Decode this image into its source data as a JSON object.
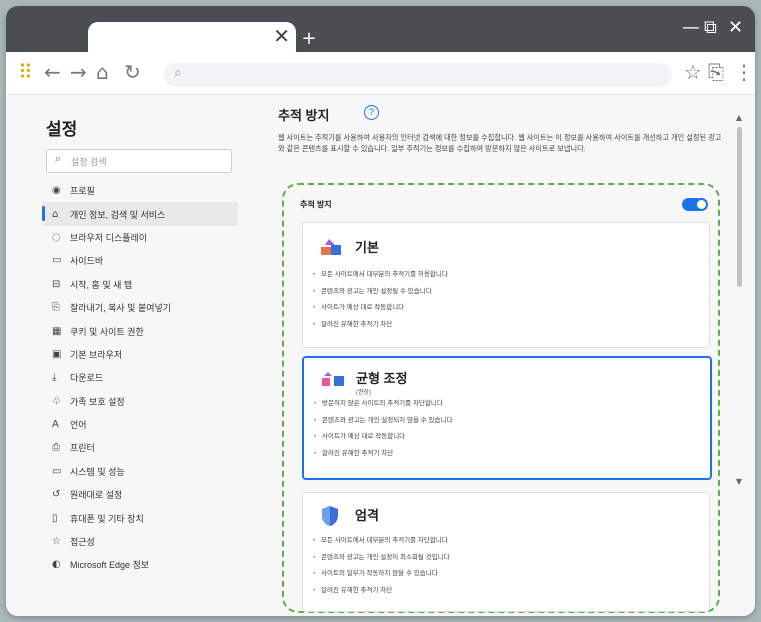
{
  "window": {
    "tab_close": "✕",
    "new_tab": "+",
    "controls": {
      "minimize": "—",
      "restore": "⧉",
      "close": "✕"
    }
  },
  "toolbar": {
    "apps_icon": "⠿",
    "back": "←",
    "forward": "→",
    "home": "⌂",
    "refresh": "↻",
    "address_icon": "⌕",
    "favorite": "☆",
    "collections": "⎘",
    "more": "⋮"
  },
  "sidebar": {
    "title": "설정",
    "search_placeholder": "설정 검색",
    "items": [
      {
        "label": "프로필",
        "icon": "◉"
      },
      {
        "label": "개인 정보, 검색 및 서비스",
        "icon": "⌂"
      },
      {
        "label": "브라우저 디스플레이",
        "icon": "◌"
      },
      {
        "label": "사이드바",
        "icon": "▭"
      },
      {
        "label": "시작, 홈 및 새 탭",
        "icon": "⊟"
      },
      {
        "label": "잘라내기, 복사 및 붙여넣기",
        "icon": "⎘"
      },
      {
        "label": "쿠키 및 사이트 권한",
        "icon": "▦"
      },
      {
        "label": "기본 브라우저",
        "icon": "▣"
      },
      {
        "label": "다운로드",
        "icon": "⤓"
      },
      {
        "label": "가족 보호 설정",
        "icon": "♧"
      },
      {
        "label": "언어",
        "icon": "A"
      },
      {
        "label": "프린터",
        "icon": "⎙"
      },
      {
        "label": "시스템 및 성능",
        "icon": "▭"
      },
      {
        "label": "원래대로 설정",
        "icon": "↺"
      },
      {
        "label": "휴대폰 및 기타 장치",
        "icon": "▯"
      },
      {
        "label": "접근성",
        "icon": "☆"
      },
      {
        "label": "Microsoft Edge 정보",
        "icon": "◐"
      }
    ],
    "active_index": 1
  },
  "main": {
    "title": "추적 방지",
    "help_icon": "?",
    "description": "웹 사이트는 추적기를 사용하여 사용자의 인터넷 검색에 대한 정보를 수집합니다. 웹 사이트는 이 정보를 사용하여 사이트를 개선하고 개인 설정된 광고와 같은 콘텐츠를 표시할 수 있습니다. 일부 추적기는 정보를 수집하여 방문하지 않은 사이트로 보냅니다.",
    "tracking_label": "추적 방지",
    "tracking_enabled": true,
    "cards": [
      {
        "title": "기본",
        "subtitle": "",
        "selected": false,
        "items": [
          "모든 사이트에서 대부분의 추적기를 허용합니다",
          "콘텐츠와 광고는 개인 설정될 수 있습니다",
          "사이트가 예상 대로 작동합니다",
          "알려진 유해한 추적기 차단"
        ]
      },
      {
        "title": "균형 조정",
        "subtitle": "(권장)",
        "selected": true,
        "items": [
          "방문하지 않은 사이트의 추적기를 차단합니다",
          "콘텐츠와 광고는 개인 설정되지 않을 수 있습니다",
          "사이트가 예상 대로 작동합니다",
          "알려진 유해한 추적기 차단"
        ]
      },
      {
        "title": "엄격",
        "subtitle": "",
        "selected": false,
        "items": [
          "모든 사이트에서 대부분의 추적기를 차단합니다",
          "콘텐츠와 광고는 개인 설정이 최소화될 것입니다",
          "사이트의 일부가 작동하지 않을 수 있습니다",
          "알려진 유해한 추적기 차단"
        ]
      }
    ]
  },
  "colors": {
    "accent": "#1a73e8",
    "highlight_border": "#5cb04a",
    "titlebar": "#4a4d51"
  }
}
